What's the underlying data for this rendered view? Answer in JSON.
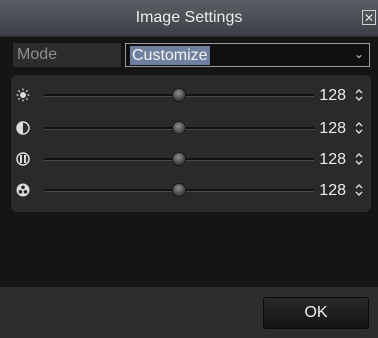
{
  "window": {
    "title": "Image Settings"
  },
  "mode": {
    "label": "Mode",
    "value": "Customize"
  },
  "sliders": [
    {
      "icon": "brightness-icon",
      "value": "128",
      "level": 0.5
    },
    {
      "icon": "contrast-icon",
      "value": "128",
      "level": 0.5
    },
    {
      "icon": "saturation-icon",
      "value": "128",
      "level": 0.5
    },
    {
      "icon": "hue-icon",
      "value": "128",
      "level": 0.5
    }
  ],
  "buttons": {
    "ok": "OK"
  },
  "colors": {
    "title_bar": "#4a4f56",
    "panel": "#2a2a2a",
    "selection": "#6f7fa0"
  }
}
